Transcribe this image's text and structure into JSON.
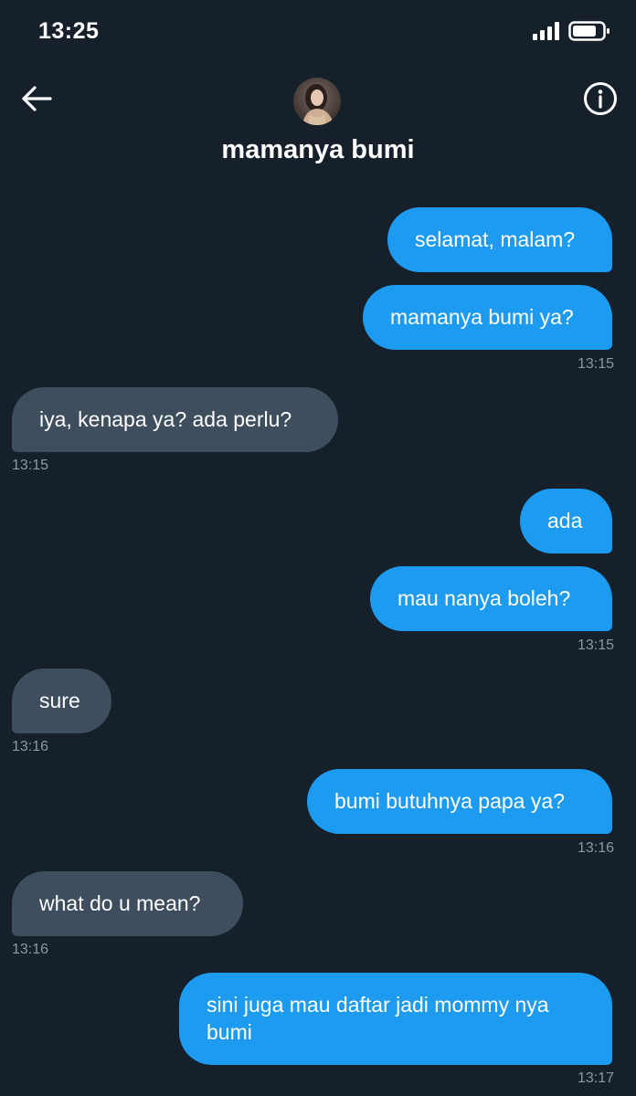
{
  "status_bar": {
    "time": "13:25",
    "signal_icon": "cellular-signal-icon",
    "battery_icon": "battery-icon"
  },
  "header": {
    "back_icon": "back-arrow-icon",
    "info_icon": "info-icon",
    "contact_name": "mamanya bumi"
  },
  "colors": {
    "background": "#15202b",
    "outgoing_bubble": "#1d9bf0",
    "incoming_bubble": "#3e4e5f",
    "timestamp": "#8b98a5"
  },
  "messages": [
    {
      "direction": "outgoing",
      "text": "selamat, malam?"
    },
    {
      "direction": "outgoing",
      "text": "mamanya bumi ya?",
      "time": "13:15"
    },
    {
      "direction": "incoming",
      "text": "iya, kenapa ya? ada perlu?",
      "time": "13:15"
    },
    {
      "direction": "outgoing",
      "text": "ada"
    },
    {
      "direction": "outgoing",
      "text": "mau nanya boleh?",
      "time": "13:15"
    },
    {
      "direction": "incoming",
      "text": "sure",
      "time": "13:16"
    },
    {
      "direction": "outgoing",
      "text": "bumi butuhnya papa ya?",
      "time": "13:16"
    },
    {
      "direction": "incoming",
      "text": "what do u mean?",
      "time": "13:16"
    },
    {
      "direction": "outgoing",
      "text": "sini juga mau daftar jadi mommy nya bumi",
      "time": "13:17"
    }
  ]
}
